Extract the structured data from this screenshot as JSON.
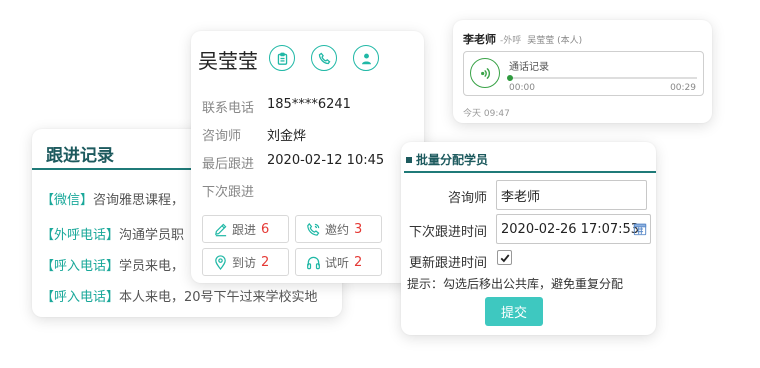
{
  "followup": {
    "title": "跟进记录",
    "records": [
      {
        "tag": "【微信】",
        "text": "咨询雅思课程，"
      },
      {
        "tag": "【外呼电话】",
        "text": "沟通学员职"
      },
      {
        "tag": "【呼入电话】",
        "text": "学员来电，"
      },
      {
        "tag": "【呼入电话】",
        "text": "本人来电，20号下午过来学校实地"
      }
    ]
  },
  "student": {
    "name": "吴莹莹",
    "icons": [
      "clipboard-icon",
      "phone-icon",
      "person-icon"
    ],
    "fields": [
      {
        "label": "联系电话",
        "value": "185****6241"
      },
      {
        "label": "咨询师",
        "value": "刘金烨"
      },
      {
        "label": "最后跟进",
        "value": "2020-02-12  10:45"
      },
      {
        "label": "下次跟进",
        "value": ""
      }
    ],
    "stats": [
      {
        "icon": "edit-icon",
        "label": "跟进",
        "count": "6"
      },
      {
        "icon": "phone-call-icon",
        "label": "邀约",
        "count": "3"
      },
      {
        "icon": "location-pin-icon",
        "label": "到访",
        "count": "2"
      },
      {
        "icon": "headphones-icon",
        "label": "试听",
        "count": "2"
      }
    ]
  },
  "call": {
    "caller": "李老师",
    "type": "-外呼",
    "student": "吴莹莹 (本人)",
    "title": "通话记录",
    "time_start": "00:00",
    "time_end": "00:29",
    "progress": 0,
    "date": "今天 09:47"
  },
  "batch": {
    "title": "批量分配学员",
    "advisor_label": "咨询师",
    "advisor_value": "李老师",
    "next_label": "下次跟进时间",
    "next_value": "2020-02-26 17:07:53",
    "update_label": "更新跟进时间",
    "update_checked": true,
    "hint": "提示：勾选后移出公共库，避免重复分配",
    "submit": "提交"
  },
  "colors": {
    "accent": "#20b8a6",
    "dark_teal": "#1d5a5e",
    "count_red": "#e53935",
    "play_green": "#3aa348",
    "submit_bg": "#3ec8c0"
  }
}
